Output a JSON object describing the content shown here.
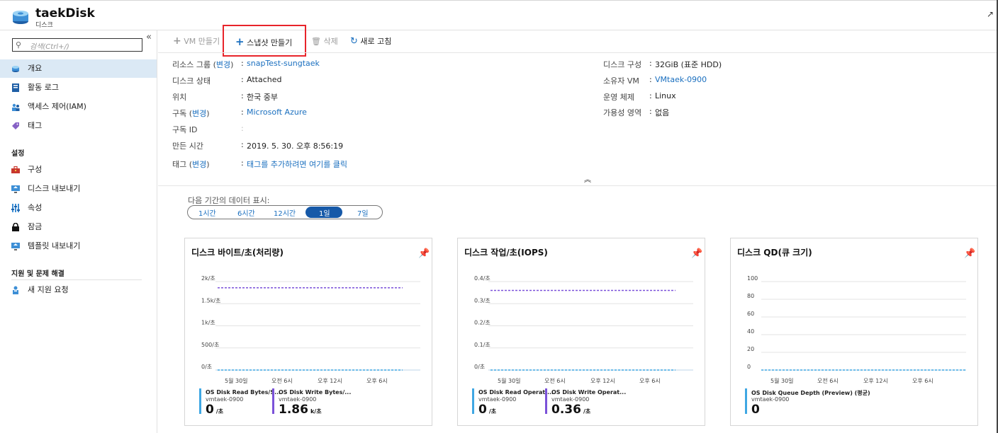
{
  "header": {
    "title": "taekDisk",
    "subtitle": "디스크"
  },
  "sidebar": {
    "search_placeholder": "검색(Ctrl+/)",
    "items": [
      {
        "label": "개요",
        "icon": "disk-icon"
      },
      {
        "label": "활동 로그",
        "icon": "log-icon"
      },
      {
        "label": "액세스 제어(IAM)",
        "icon": "people-icon"
      },
      {
        "label": "태그",
        "icon": "tag-icon"
      }
    ],
    "settings_header": "설정",
    "settings_items": [
      {
        "label": "구성",
        "icon": "toolbox-icon"
      },
      {
        "label": "디스크 내보내기",
        "icon": "export-icon"
      },
      {
        "label": "속성",
        "icon": "properties-icon"
      },
      {
        "label": "잠금",
        "icon": "lock-icon"
      },
      {
        "label": "템플릿 내보내기",
        "icon": "template-icon"
      }
    ],
    "support_header": "지원 및 문제 해결",
    "support_items": [
      {
        "label": "새 지원 요청",
        "icon": "support-icon"
      }
    ]
  },
  "toolbar": {
    "create_vm": "VM 만들기",
    "create_snapshot": "스냅샷 만들기",
    "delete": "삭제",
    "refresh": "새로 고침"
  },
  "properties": {
    "change": "변경",
    "resource_group_label": "리소스 그룹",
    "resource_group": "snapTest-sungtaek",
    "disk_state_label": "디스크 상태",
    "disk_state": "Attached",
    "location_label": "위치",
    "location": "한국 중부",
    "subscription_label": "구독",
    "subscription": "Microsoft Azure",
    "subscription_id_label": "구독 ID",
    "subscription_id": "",
    "created_label": "만든 시간",
    "created": "2019. 5. 30. 오후 8:56:19",
    "tags_label": "태그",
    "tags": "태그를 추가하려면 여기를 클릭",
    "config_label": "디스크 구성",
    "config": "32GiB (표준 HDD)",
    "owner_vm_label": "소유자 VM",
    "owner_vm": "VMtaek-0900",
    "os_label": "운영 체제",
    "os": "Linux",
    "zone_label": "가용성 영역",
    "zone": "없음"
  },
  "time_range": {
    "label": "다음 기간의 데이터 표시:",
    "options": [
      "1시간",
      "6시간",
      "12시간",
      "1일",
      "7일"
    ],
    "selected": "1일"
  },
  "colors": {
    "accent": "#1659a8",
    "series_blue": "#3fa7e3",
    "series_purple": "#7b52d9",
    "highlight": "#e8242a"
  },
  "chart_data": [
    {
      "type": "line",
      "title": "디스크 바이트/초(처리량)",
      "y_ticks": [
        "0/초",
        "500/초",
        "1k/초",
        "1.5k/초",
        "2k/초"
      ],
      "ylim": [
        0,
        2000
      ],
      "x_ticks": [
        "5월 30일",
        "오전 6시",
        "오후 12시",
        "오후 6시"
      ],
      "series": [
        {
          "name": "OS Disk Read Bytes/S...",
          "values": [
            0,
            0
          ],
          "style": "dashed",
          "color": "#3fa7e3"
        },
        {
          "name": "OS Disk Write Bytes/...",
          "values": [
            1860,
            1860
          ],
          "style": "dashed",
          "color": "#7b52d9"
        }
      ],
      "legend": [
        {
          "name": "OS Disk Read Bytes/S...",
          "resource": "vmtaek-0900",
          "value": "0",
          "unit": "/초",
          "color": "#3fa7e3"
        },
        {
          "name": "OS Disk Write Bytes/...",
          "resource": "vmtaek-0900",
          "value": "1.86",
          "unit": "k/초",
          "color": "#7b52d9"
        }
      ]
    },
    {
      "type": "line",
      "title": "디스크 작업/초(IOPS)",
      "y_ticks": [
        "0/초",
        "0.1/초",
        "0.2/초",
        "0.3/초",
        "0.4/초"
      ],
      "ylim": [
        0,
        0.4
      ],
      "x_ticks": [
        "5월 30일",
        "오전 6시",
        "오후 12시",
        "오후 6시"
      ],
      "series": [
        {
          "name": "OS Disk Read Operati...",
          "values": [
            0,
            0
          ],
          "style": "dashed",
          "color": "#3fa7e3"
        },
        {
          "name": "OS Disk Write Operat...",
          "values": [
            0.36,
            0.36
          ],
          "style": "dashed",
          "color": "#7b52d9"
        }
      ],
      "legend": [
        {
          "name": "OS Disk Read Operati...",
          "resource": "vmtaek-0900",
          "value": "0",
          "unit": "/초",
          "color": "#3fa7e3"
        },
        {
          "name": "OS Disk Write Operat...",
          "resource": "vmtaek-0900",
          "value": "0.36",
          "unit": "/초",
          "color": "#7b52d9"
        }
      ]
    },
    {
      "type": "line",
      "title": "디스크 QD(큐 크기)",
      "y_ticks": [
        "0",
        "20",
        "40",
        "60",
        "80",
        "100"
      ],
      "ylim": [
        0,
        100
      ],
      "x_ticks": [
        "5월 30일",
        "오전 6시",
        "오후 12시",
        "오후 6시"
      ],
      "series": [
        {
          "name": "OS Disk Queue Depth (Preview) (평균)",
          "values": [
            0,
            0
          ],
          "style": "dashed",
          "color": "#3fa7e3"
        }
      ],
      "legend": [
        {
          "name": "OS Disk Queue Depth (Preview) (평균)",
          "resource": "vmtaek-0900",
          "value": "0",
          "unit": "",
          "color": "#3fa7e3"
        }
      ]
    }
  ]
}
